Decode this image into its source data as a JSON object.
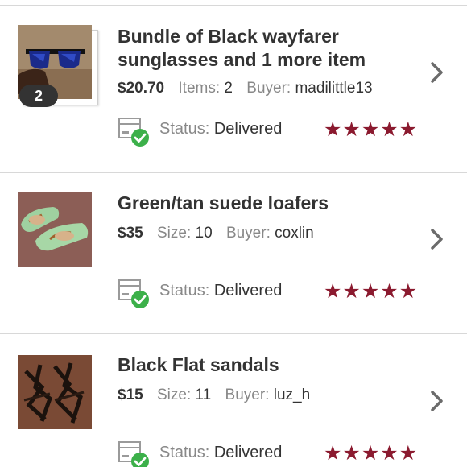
{
  "orders": [
    {
      "title": "Bundle of Black wayfarer sunglasses and 1 more item",
      "price": "$20.70",
      "detail_key": "Items:",
      "detail_value": "2",
      "buyer_key": "Buyer:",
      "buyer_value": "madilittle13",
      "bundle_count": "2",
      "status_key": "Status:",
      "status_value": "Delivered",
      "rating": "★★★★★",
      "thumbnail_icon": "sunglasses-photo"
    },
    {
      "title": "Green/tan suede loafers",
      "price": "$35",
      "detail_key": "Size:",
      "detail_value": "10",
      "buyer_key": "Buyer:",
      "buyer_value": "coxlin",
      "status_key": "Status:",
      "status_value": "Delivered",
      "rating": "★★★★★",
      "thumbnail_icon": "loafers-photo"
    },
    {
      "title": "Black Flat sandals",
      "price": "$15",
      "detail_key": "Size:",
      "detail_value": "11",
      "buyer_key": "Buyer:",
      "buyer_value": "luz_h",
      "status_key": "Status:",
      "status_value": "Delivered",
      "rating": "★★★★★",
      "thumbnail_icon": "sandals-photo"
    }
  ],
  "colors": {
    "star": "#8b1a2f",
    "delivered_check": "#3cb04a",
    "badge_bg": "#333333"
  }
}
